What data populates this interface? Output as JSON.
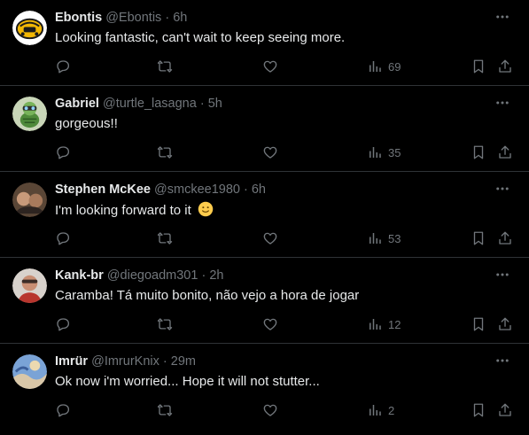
{
  "colors": {
    "background": "#000000",
    "text": "#e7e9ea",
    "muted": "#71767b",
    "divider": "#2f3336"
  },
  "tweets": [
    {
      "name": "Ebontis",
      "handle": "@Ebontis",
      "sep": "·",
      "time": "6h",
      "text": "Looking fantastic, can't wait to keep seeing more.",
      "views": "69",
      "avatar_icon": "yellow-logo-avatar"
    },
    {
      "name": "Gabriel",
      "handle": "@turtle_lasagna",
      "sep": "·",
      "time": "5h",
      "text": "gorgeous!!",
      "views": "35",
      "avatar_icon": "turtle-avatar"
    },
    {
      "name": "Stephen McKee",
      "handle": "@smckee1980",
      "sep": "·",
      "time": "6h",
      "text": "I'm looking forward to it",
      "views": "53",
      "avatar_icon": "photo-avatar",
      "emoji": "slightly-smiling-face"
    },
    {
      "name": "Kank-br",
      "handle": "@diegoadm301",
      "sep": "·",
      "time": "2h",
      "text": "Caramba! Tá muito bonito, não vejo a hora de jogar",
      "views": "12",
      "avatar_icon": "photo-avatar"
    },
    {
      "name": "Imrür",
      "handle": "@ImrurKnix",
      "sep": "·",
      "time": "29m",
      "text": "Ok now i'm worried... Hope it will not stutter...",
      "views": "2",
      "avatar_icon": "painting-avatar"
    }
  ],
  "icons": [
    "reply-icon",
    "retweet-icon",
    "like-icon",
    "views-icon",
    "bookmark-icon",
    "share-icon",
    "more-icon"
  ]
}
